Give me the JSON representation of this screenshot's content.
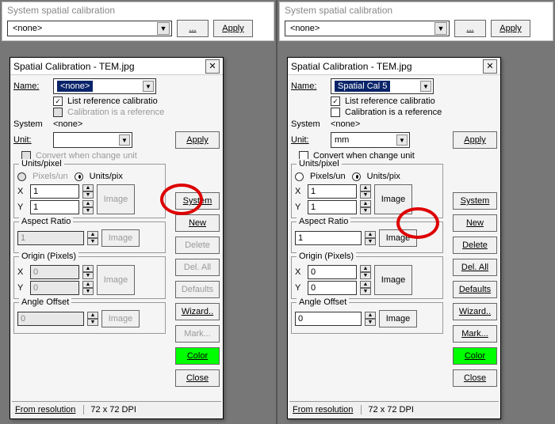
{
  "sysbar": {
    "title": "System spatial calibration",
    "value": "<none>",
    "browse": "...",
    "apply": "Apply"
  },
  "dialog": {
    "title": "Spatial Calibration - TEM.jpg",
    "name_label": "Name:",
    "list_ref": "List reference calibratio",
    "cal_is_ref": "Calibration is a reference",
    "system_label": "System",
    "system_value": "<none>",
    "unit_label": "Unit:",
    "apply": "Apply",
    "convert": "Convert when change unit",
    "units_legend": "Units/pixel",
    "pix_un": "Pixels/un",
    "un_pix": "Units/pix",
    "x": "X",
    "y": "Y",
    "image": "Image",
    "aspect_legend": "Aspect Ratio",
    "origin_legend": "Origin (Pixels)",
    "angle_legend": "Angle Offset",
    "val1": "1",
    "val0": "0",
    "status_res": "From resolution",
    "status_dpi": "72 x 72 DPI"
  },
  "left": {
    "name_value": "<none>",
    "unit_value": ""
  },
  "right": {
    "name_value": "Spatial Cal 5",
    "unit_value": "mm"
  },
  "buttons": {
    "system": "System",
    "new": "New",
    "delete": "Delete",
    "del_all": "Del. All",
    "defaults": "Defaults",
    "wizard": "Wizard..",
    "mark": "Mark...",
    "color": "Color",
    "close": "Close"
  }
}
